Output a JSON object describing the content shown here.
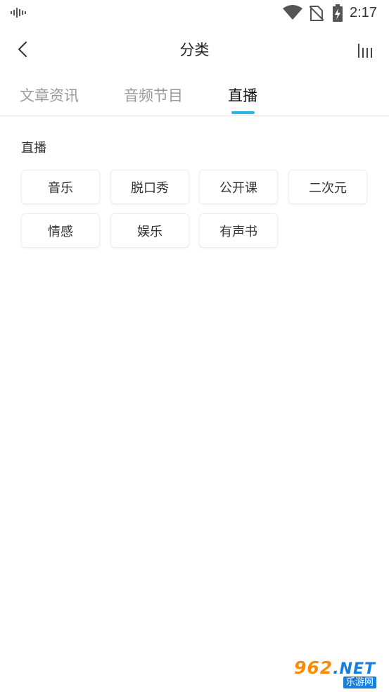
{
  "status_bar": {
    "time": "2:17",
    "icons": [
      "audio-wave-icon",
      "wifi-icon",
      "no-sim-icon",
      "battery-charging-icon"
    ]
  },
  "nav": {
    "title": "分类",
    "back_icon": "chevron-left-icon",
    "sort_icon": "bars-icon"
  },
  "tabs": [
    {
      "label": "文章资讯",
      "active": false
    },
    {
      "label": "音频节目",
      "active": false
    },
    {
      "label": "直播",
      "active": true
    }
  ],
  "section": {
    "title": "直播",
    "tags": [
      "音乐",
      "脱口秀",
      "公开课",
      "二次元",
      "情感",
      "娱乐",
      "有声书"
    ]
  },
  "watermark": {
    "number": "962",
    "domain": ".NET",
    "site_name": "乐游网"
  },
  "colors": {
    "accent": "#29b6e6",
    "text_primary": "#222222",
    "text_inactive": "#9a9a9a",
    "divider": "#e6e6e6"
  }
}
